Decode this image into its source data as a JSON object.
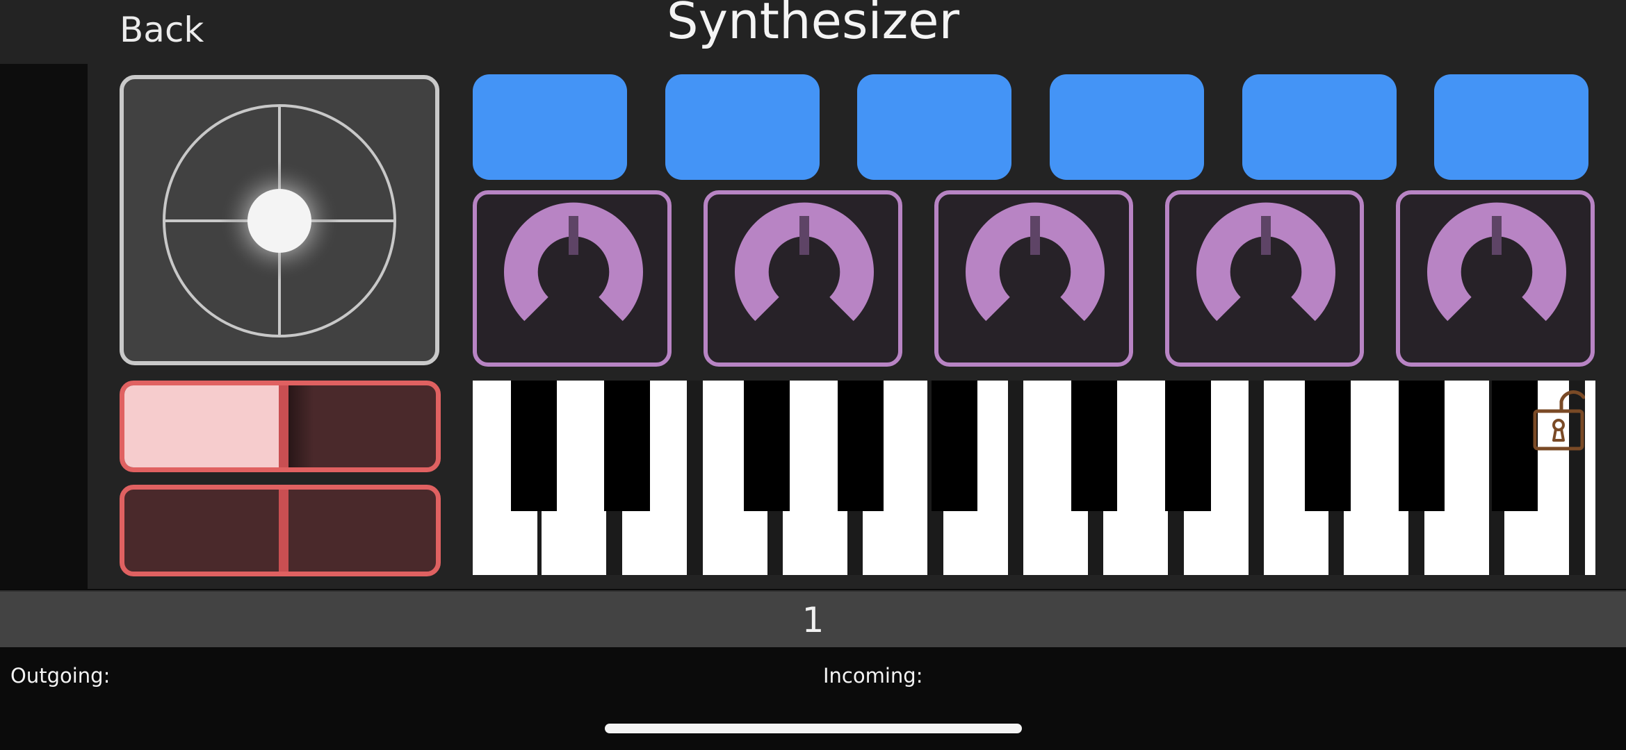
{
  "header": {
    "back_label": "Back",
    "title": "Synthesizer"
  },
  "colors": {
    "pad": "#4494f6",
    "knob": "#b884c4",
    "slider": "#e06161",
    "slider_fill": "#f6cccd",
    "xy_pad_border": "#c9c9c9",
    "lock_icon": "#7a4a26"
  },
  "xy_pad": {
    "icon": "crosshair-circle"
  },
  "pads": [
    {
      "name": "pad-1"
    },
    {
      "name": "pad-2"
    },
    {
      "name": "pad-3"
    },
    {
      "name": "pad-4"
    },
    {
      "name": "pad-5"
    },
    {
      "name": "pad-6"
    }
  ],
  "knobs": [
    {
      "name": "knob-1",
      "value": 0.5
    },
    {
      "name": "knob-2",
      "value": 0.5
    },
    {
      "name": "knob-3",
      "value": 0.5
    },
    {
      "name": "knob-4",
      "value": 0.5
    },
    {
      "name": "knob-5",
      "value": 0.5
    }
  ],
  "sliders": [
    {
      "name": "slider-1",
      "value": 0.5
    },
    {
      "name": "slider-2",
      "value": 0.5
    }
  ],
  "keyboard": {
    "white_keys": 14,
    "lock_icon": "unlocked-padlock"
  },
  "channel": {
    "value": "1"
  },
  "footer": {
    "outgoing_label": "Outgoing:",
    "incoming_label": "Incoming:"
  }
}
